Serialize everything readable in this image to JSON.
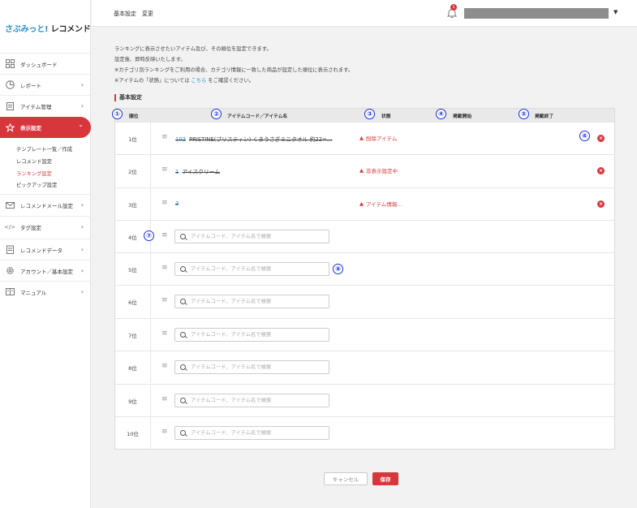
{
  "brand": {
    "part1": "さぶみっと!",
    "part2": " レコメンド"
  },
  "sidebar": {
    "items": [
      {
        "label": "ダッシュボード",
        "icon": "dashboard-icon",
        "chevron": ""
      },
      {
        "label": "レポート",
        "icon": "report-icon",
        "chevron": "›"
      },
      {
        "label": "アイテム管理",
        "icon": "item-icon",
        "chevron": "›"
      },
      {
        "label": "表示設定",
        "icon": "star-icon",
        "chevron": "⌄"
      },
      {
        "label": "レコメンドメール設定",
        "icon": "mail-icon",
        "chevron": "›"
      },
      {
        "label": "タグ設定",
        "icon": "code-icon",
        "chevron": "›"
      },
      {
        "label": "レコメンドデータ",
        "icon": "data-icon",
        "chevron": "›"
      },
      {
        "label": "アカウント／基本設定",
        "icon": "gear-icon",
        "chevron": "›"
      },
      {
        "label": "マニュアル",
        "icon": "book-icon",
        "chevron": "›"
      }
    ],
    "subitems": [
      "テンプレート一覧／作成",
      "レコメンド設定",
      "ランキング設定",
      "ピックアップ設定"
    ]
  },
  "header": {
    "title": "基本設定　変更",
    "notification_count": "1"
  },
  "notes": {
    "line1": "ランキングに表示させたいアイテム及び、その順位を設定できます。",
    "line2": "設定後、即時反映いたします。",
    "line3": "※カテゴリ別ランキングをご利用の場合、カテゴリ情報に一致した商品が設定した順位に表示されます。",
    "line4_a": "※アイテムの「状態」については ",
    "line4_link": "こちら",
    "line4_b": " をご確認ください。"
  },
  "section_title": "基本設定",
  "table": {
    "headers": {
      "rank": "順位",
      "item": "アイテムコード／アイテム名",
      "status": "状態",
      "start": "掲載開始",
      "end": "掲載終了"
    },
    "rows": [
      {
        "rank": "1位",
        "code": "102",
        "name": "PRISTINE(プリスティン) くまうさぎミニタオル 約22×…",
        "status": "削除アイテム"
      },
      {
        "rank": "2位",
        "code": "1",
        "name": "アイスクリーム",
        "status": "非表示設定中"
      },
      {
        "rank": "3位",
        "code": "2",
        "name": "",
        "status": "アイテム情報…"
      },
      {
        "rank": "4位",
        "placeholder": "アイテムコード、アイテム名で検索"
      },
      {
        "rank": "5位",
        "placeholder": "アイテムコード、アイテム名で検索"
      },
      {
        "rank": "6位",
        "placeholder": "アイテムコード、アイテム名で検索"
      },
      {
        "rank": "7位",
        "placeholder": "アイテムコード、アイテム名で検索"
      },
      {
        "rank": "8位",
        "placeholder": "アイテムコード、アイテム名で検索"
      },
      {
        "rank": "9位",
        "placeholder": "アイテムコード、アイテム名で検索"
      },
      {
        "rank": "10位",
        "placeholder": "アイテムコード、アイテム名で検索"
      }
    ]
  },
  "annotations": [
    "①",
    "②",
    "③",
    "④",
    "⑤",
    "⑥",
    "⑦",
    "⑧"
  ],
  "buttons": {
    "cancel": "キャンセル",
    "save": "保存"
  },
  "colors": {
    "accent": "#d8363d",
    "link": "#1f8fd6",
    "annotation": "#1a2ee0"
  }
}
